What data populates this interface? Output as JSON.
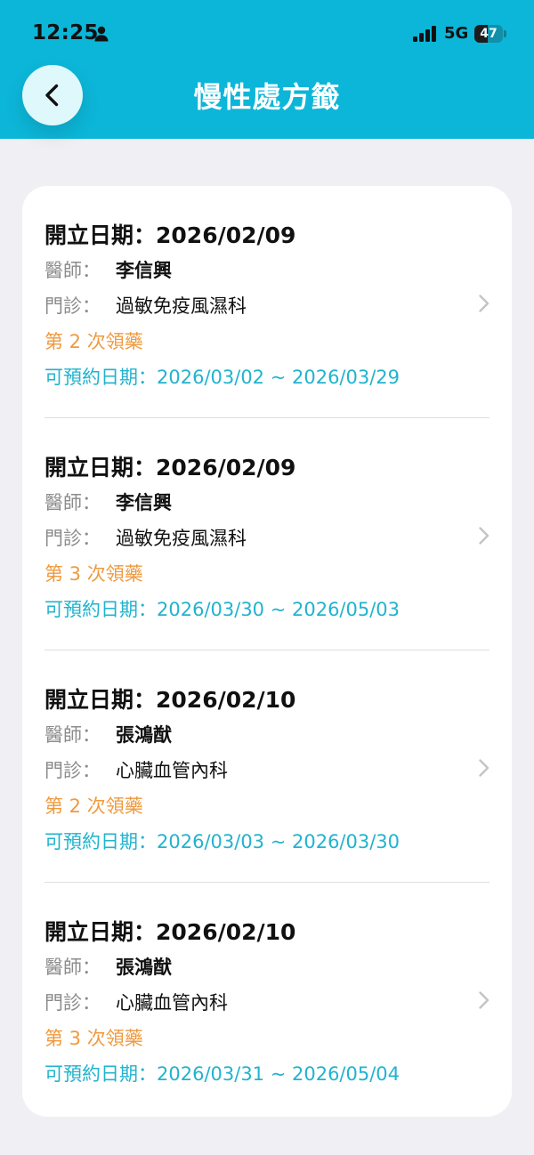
{
  "status_bar": {
    "time": "12:25",
    "network": "5G",
    "battery": "47",
    "battery_level": 0.47,
    "icons": [
      "person-icon",
      "signal-icon",
      "battery-icon"
    ]
  },
  "header": {
    "title": "慢性處方籤",
    "back_icon": "chevron-left-icon"
  },
  "labels": {
    "issue_date": "開立日期：",
    "doctor": "醫師：",
    "clinic": "門診：",
    "booking": "可預約日期："
  },
  "prescriptions": [
    {
      "issue_date": "2026/02/09",
      "doctor": "李信興",
      "clinic": "過敏免疫風濕科",
      "refill": "第 2 次領藥",
      "booking_range": "2026/03/02 ~ 2026/03/29"
    },
    {
      "issue_date": "2026/02/09",
      "doctor": "李信興",
      "clinic": "過敏免疫風濕科",
      "refill": "第 3 次領藥",
      "booking_range": "2026/03/30 ~ 2026/05/03"
    },
    {
      "issue_date": "2026/02/10",
      "doctor": "張鴻猷",
      "clinic": "心臟血管內科",
      "refill": "第 2 次領藥",
      "booking_range": "2026/03/03 ~ 2026/03/30"
    },
    {
      "issue_date": "2026/02/10",
      "doctor": "張鴻猷",
      "clinic": "心臟血管內科",
      "refill": "第 3 次領藥",
      "booking_range": "2026/03/31 ~ 2026/05/04"
    }
  ],
  "colors": {
    "header": "#0cb6d8",
    "refill": "#ef9a3e",
    "booking": "#21b3cf"
  }
}
